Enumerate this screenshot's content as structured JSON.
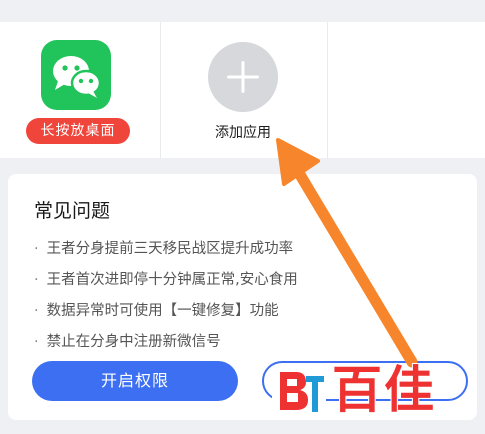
{
  "apps": {
    "wechat": {
      "icon": "wechat-icon",
      "badge_label": "长按放桌面"
    },
    "add": {
      "icon": "plus-icon",
      "label": "添加应用"
    }
  },
  "faq": {
    "title": "常见问题",
    "items": [
      "王者分身提前三天移民战区提升成功率",
      "王者首次进即停十分钟属正常,安心食用",
      "数据异常时可使用【一键修复】功能",
      "禁止在分身中注册新微信号"
    ],
    "primary_button": "开启权限"
  },
  "watermark": {
    "text": "百佳"
  },
  "colors": {
    "accent": "#3d6ff2",
    "badge": "#f0453a",
    "wechat": "#21c45a",
    "arrow": "#f7852b",
    "watermark": "#ee3232"
  }
}
